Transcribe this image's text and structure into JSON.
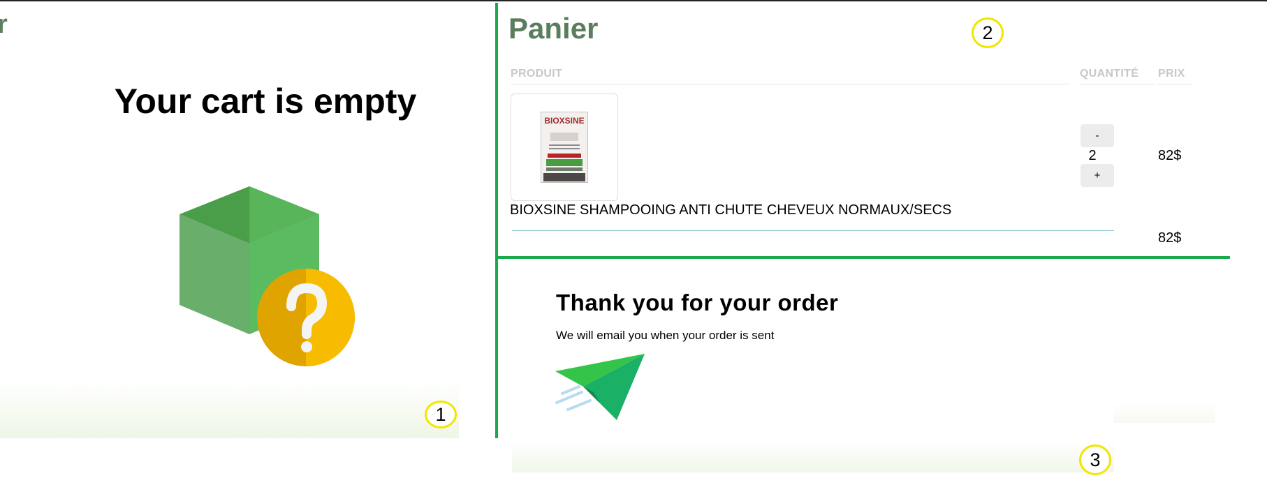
{
  "panel1": {
    "cut_title_fragment": "r",
    "empty_message": "Your cart is empty",
    "badge": "1"
  },
  "cart": {
    "title": "Panier",
    "badge": "2",
    "columns": {
      "product": "PRODUIT",
      "quantity": "QUANTITÉ",
      "price": "PRIX"
    },
    "items": [
      {
        "name": "BIOXSINE SHAMPOOING ANTI CHUTE CHEVEUX NORMAUX/SECS",
        "image_brand_text": "BIOXSINE",
        "quantity": "2",
        "price": "82$",
        "decrement_label": "-",
        "increment_label": "+"
      }
    ],
    "total": "82$"
  },
  "thank_you": {
    "title": "Thank you for your order",
    "subtitle": "We will email you when your order is sent",
    "badge": "3"
  },
  "colors": {
    "divider": "#1aaa4c",
    "title_green": "#5a7d5e",
    "badge_ring": "#f2e600",
    "cube_green": "#5cb85c",
    "question_orange": "#f4b400"
  },
  "icons": [
    "empty-box-question-icon",
    "paper-plane-icon",
    "product-image"
  ]
}
